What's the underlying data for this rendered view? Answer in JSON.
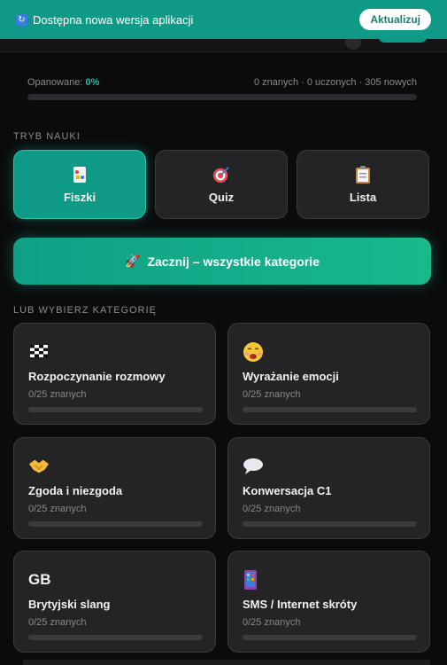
{
  "banner": {
    "message": "Dostępna nowa wersja aplikacji",
    "button": "Aktualizuj",
    "icon": "refresh-icon"
  },
  "progress": {
    "label": "Opanowane:",
    "percent_text": "0%",
    "percent": 0,
    "stats": "0 znanych · 0 uczonych · 305 nowych"
  },
  "mode_section": {
    "label": "Tryb nauki",
    "modes": [
      {
        "label": "Fiszki",
        "icon": "flashcards-icon",
        "active": true
      },
      {
        "label": "Quiz",
        "icon": "target-icon",
        "active": false
      },
      {
        "label": "Lista",
        "icon": "clipboard-icon",
        "active": false
      }
    ]
  },
  "start_button": {
    "label": "Zacznij – wszystkie kategorie",
    "icon": "rocket-icon"
  },
  "category_section": {
    "label": "lub wybierz kategorię",
    "categories": [
      {
        "title": "Rozpoczynanie rozmowy",
        "sub": "0/25 znanych",
        "icon": "chequered-flag-icon",
        "progress": 0
      },
      {
        "title": "Wyrażanie emocji",
        "sub": "0/25 znanych",
        "icon": "emotion-face-icon",
        "progress": 0
      },
      {
        "title": "Zgoda i niezgoda",
        "sub": "0/25 znanych",
        "icon": "handshake-icon",
        "progress": 0
      },
      {
        "title": "Konwersacja C1",
        "sub": "0/25 znanych",
        "icon": "speech-bubble-icon",
        "progress": 0
      },
      {
        "title": "Brytyjski slang",
        "sub": "0/25 znanych",
        "icon": "gb-flag-icon",
        "icon_text": "GB",
        "progress": 0
      },
      {
        "title": "SMS / Internet skróty",
        "sub": "0/25 znanych",
        "icon": "mobile-phone-icon",
        "progress": 0
      }
    ]
  },
  "colors": {
    "accent": "#19c3a6",
    "banner": "#0f9a87",
    "card": "#242427",
    "background": "#0b0b0c"
  }
}
